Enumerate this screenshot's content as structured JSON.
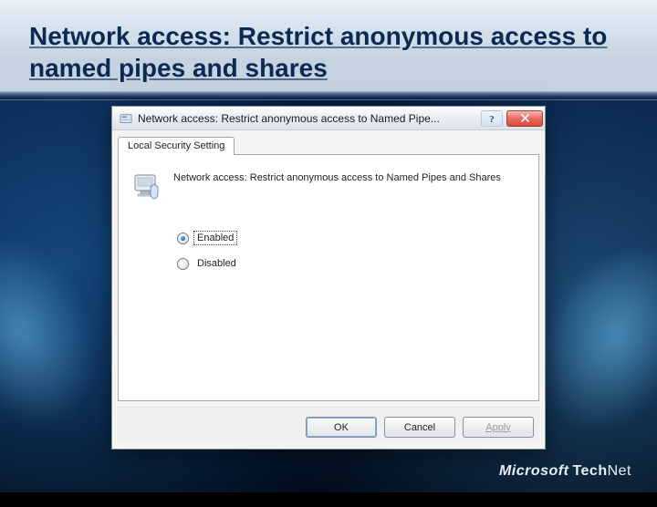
{
  "slide": {
    "title": "Network access: Restrict anonymous access to named pipes and shares",
    "brand_ms": "Microsoft",
    "brand_tn_tech": "Tech",
    "brand_tn_net": "Net"
  },
  "dialog": {
    "title": "Network access: Restrict anonymous access to Named Pipe...",
    "tab_label": "Local Security Setting",
    "description": "Network access: Restrict anonymous access to Named Pipes and Shares",
    "options": {
      "enabled": "Enabled",
      "disabled": "Disabled",
      "selected": "enabled"
    },
    "buttons": {
      "ok": "OK",
      "cancel": "Cancel",
      "apply": "Apply"
    }
  }
}
